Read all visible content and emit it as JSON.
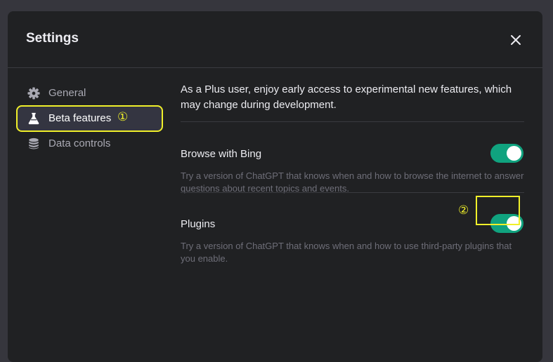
{
  "dialog": {
    "title": "Settings",
    "close_icon": "close-icon"
  },
  "sidebar": {
    "items": [
      {
        "label": "General",
        "icon": "gear-icon",
        "active": false
      },
      {
        "label": "Beta features",
        "icon": "flask-icon",
        "active": true
      },
      {
        "label": "Data controls",
        "icon": "database-icon",
        "active": false
      }
    ]
  },
  "content": {
    "intro": "As a Plus user, enjoy early access to experimental new features, which may change during development.",
    "features": [
      {
        "title": "Browse with Bing",
        "description": "Try a version of ChatGPT that knows when and how to browse the internet to answer questions about recent topics and events.",
        "enabled": true
      },
      {
        "title": "Plugins",
        "description": "Try a version of ChatGPT that knows when and how to use third-party plugins that you enable.",
        "enabled": true
      }
    ]
  },
  "annotations": {
    "marker_1": "①",
    "marker_2": "②",
    "highlight_color": "#f0f02a"
  },
  "colors": {
    "accent": "#10a37f",
    "background": "#202123",
    "page_background": "#36363d"
  }
}
